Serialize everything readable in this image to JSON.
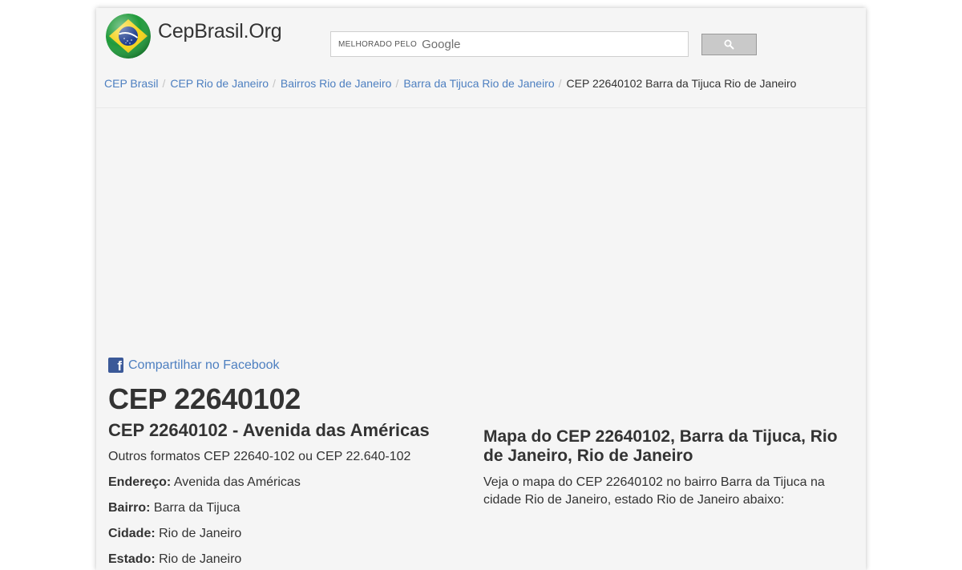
{
  "header": {
    "site_name": "CepBrasil.Org",
    "search": {
      "enhanced_by": "MELHORADO PELO",
      "brand": "Google"
    }
  },
  "breadcrumb": [
    "CEP Brasil",
    "CEP Rio de Janeiro",
    "Bairros Rio de Janeiro",
    "Barra da Tijuca Rio de Janeiro",
    "CEP 22640102 Barra da Tijuca Rio de Janeiro"
  ],
  "share": {
    "facebook_label": "Compartilhar no Facebook"
  },
  "main": {
    "title": "CEP 22640102",
    "subtitle": "CEP 22640102 - Avenida das Américas",
    "formats": "Outros formatos CEP 22640-102 ou CEP 22.640-102",
    "fields": [
      {
        "label": "Endereço:",
        "value": "Avenida das Américas"
      },
      {
        "label": "Bairro:",
        "value": "Barra da Tijuca"
      },
      {
        "label": "Cidade:",
        "value": "Rio de Janeiro"
      },
      {
        "label": "Estado:",
        "value": "Rio de Janeiro"
      }
    ]
  },
  "map": {
    "title": "Mapa do CEP 22640102, Barra da Tijuca, Rio de Janeiro, Rio de Janeiro",
    "description": "Veja o mapa do CEP 22640102 no bairro Barra da Tijuca na cidade Rio de Janeiro, estado Rio de Janeiro abaixo:"
  },
  "colors": {
    "link": "#4d7fc0",
    "page_background": "#f5f5f5",
    "text": "#333333",
    "facebook": "#3b5998"
  },
  "icons": {
    "logo": "brazil-flag-icon",
    "search": "magnifier-icon",
    "share": "facebook-icon"
  }
}
